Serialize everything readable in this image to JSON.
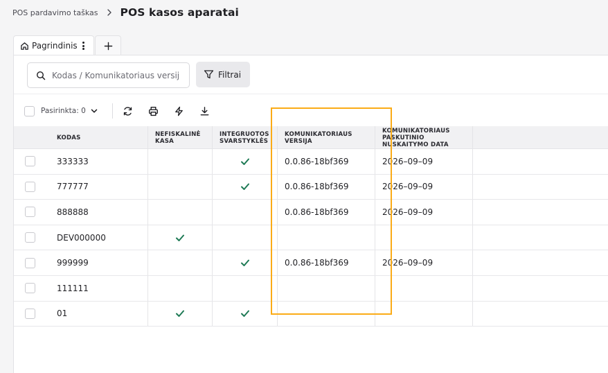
{
  "breadcrumb": {
    "parent": "POS pardavimo taškas",
    "title": "POS kasos aparatai"
  },
  "tabs": {
    "home_label": "Pagrindinis"
  },
  "search": {
    "placeholder": "Kodas / Komunikatoriaus versij"
  },
  "filters": {
    "label": "Filtrai"
  },
  "toolbar": {
    "selected_label": "Pasirinkta: 0"
  },
  "table": {
    "columns": [
      "KODAS",
      "NEFISKALINĖ KASA",
      "INTEGRUOTOS SVARSTYKLĖS",
      "KOMUNIKATORIAUS VERSIJA",
      "KOMUNIKATORIAUS PASKUTINIO NUSKAITYMO DATA"
    ],
    "rows": [
      {
        "code": "333333",
        "non_fiscal": false,
        "scales": true,
        "version": "0.0.86-18bf369",
        "date": "2026–09–09"
      },
      {
        "code": "777777",
        "non_fiscal": false,
        "scales": true,
        "version": "0.0.86-18bf369",
        "date": "2026–09–09"
      },
      {
        "code": "888888",
        "non_fiscal": false,
        "scales": false,
        "version": "0.0.86-18bf369",
        "date": "2026–09–09"
      },
      {
        "code": "DEV000000",
        "non_fiscal": true,
        "scales": false,
        "version": "",
        "date": ""
      },
      {
        "code": "999999",
        "non_fiscal": false,
        "scales": true,
        "version": "0.0.86-18bf369",
        "date": "2026–09–09"
      },
      {
        "code": "111111",
        "non_fiscal": false,
        "scales": false,
        "version": "",
        "date": ""
      },
      {
        "code": "01",
        "non_fiscal": true,
        "scales": true,
        "version": "",
        "date": ""
      }
    ]
  },
  "colors": {
    "check": "#1e7a55",
    "highlight": "#fbab16"
  }
}
